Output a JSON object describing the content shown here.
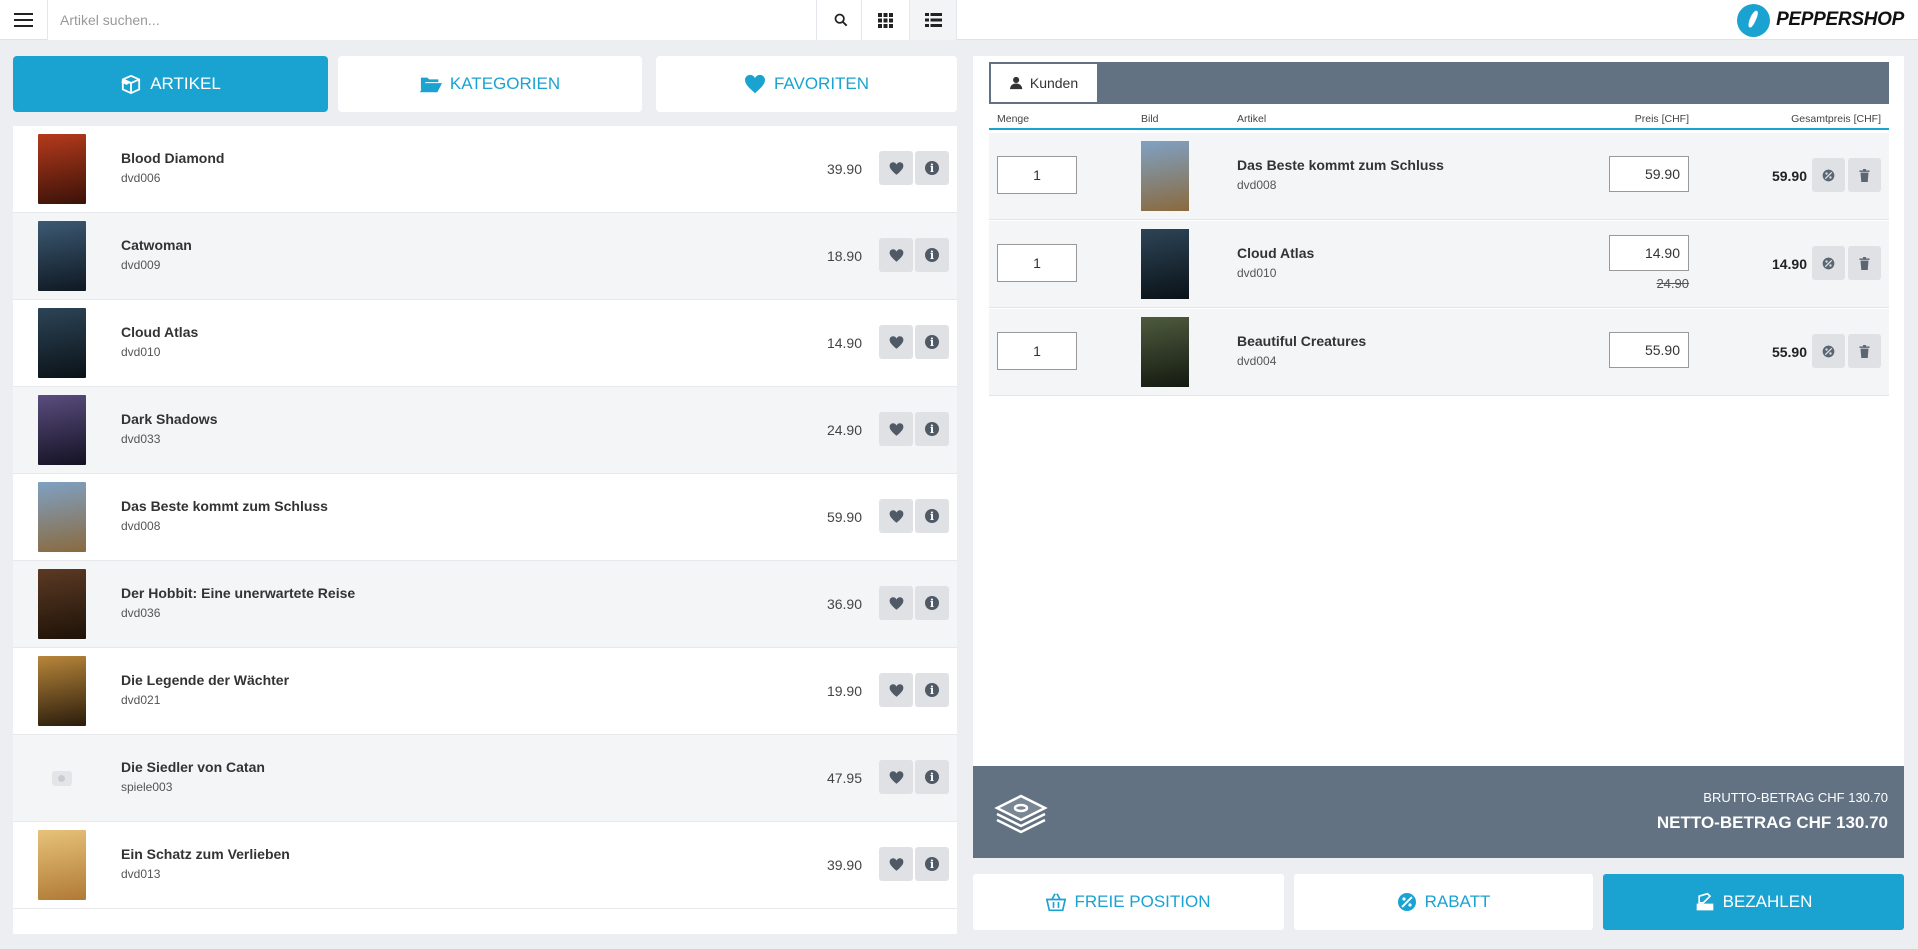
{
  "app": {
    "brand_name": "PEPPERSHOP"
  },
  "search": {
    "placeholder": "Artikel suchen..."
  },
  "nav_tabs": [
    {
      "label": "ARTIKEL",
      "icon": "box-icon",
      "active": true
    },
    {
      "label": "KATEGORIEN",
      "icon": "folder-open-icon",
      "active": false
    },
    {
      "label": "FAVORITEN",
      "icon": "heart-icon",
      "active": false
    }
  ],
  "products": [
    {
      "name": "Blood Diamond",
      "sku": "dvd006",
      "price": "39.90",
      "poster_colors": [
        "#b53a1c",
        "#3a1208"
      ]
    },
    {
      "name": "Catwoman",
      "sku": "dvd009",
      "price": "18.90",
      "poster_colors": [
        "#3c5a74",
        "#0f1822"
      ]
    },
    {
      "name": "Cloud Atlas",
      "sku": "dvd010",
      "price": "14.90",
      "poster_colors": [
        "#2d4456",
        "#0a1218"
      ]
    },
    {
      "name": "Dark Shadows",
      "sku": "dvd033",
      "price": "24.90",
      "poster_colors": [
        "#5a4d7e",
        "#141224"
      ]
    },
    {
      "name": "Das Beste kommt zum Schluss",
      "sku": "dvd008",
      "price": "59.90",
      "poster_colors": [
        "#7fa1c4",
        "#8a6a3e"
      ]
    },
    {
      "name": "Der Hobbit: Eine unerwartete Reise",
      "sku": "dvd036",
      "price": "36.90",
      "poster_colors": [
        "#5b3a24",
        "#1e1208"
      ]
    },
    {
      "name": "Die Legende der Wächter",
      "sku": "dvd021",
      "price": "19.90",
      "poster_colors": [
        "#b8863a",
        "#2a1c0c"
      ]
    },
    {
      "name": "Die Siedler von Catan",
      "sku": "spiele003",
      "price": "47.95",
      "poster_colors": null
    },
    {
      "name": "Ein Schatz zum Verlieben",
      "sku": "dvd013",
      "price": "39.90",
      "poster_colors": [
        "#e7c27a",
        "#b07a34"
      ]
    }
  ],
  "cart": {
    "customer_tab_label": "Kunden",
    "columns": {
      "qty": "Menge",
      "image": "Bild",
      "article": "Artikel",
      "price": "Preis [CHF]",
      "total": "Gesamtpreis [CHF]"
    },
    "items": [
      {
        "qty": "1",
        "name": "Das Beste kommt zum Schluss",
        "sku": "dvd008",
        "price": "59.90",
        "old_price": "",
        "total": "59.90",
        "poster_colors": [
          "#7fa1c4",
          "#8a6a3e"
        ]
      },
      {
        "qty": "1",
        "name": "Cloud Atlas",
        "sku": "dvd010",
        "price": "14.90",
        "old_price": "24.90",
        "total": "14.90",
        "poster_colors": [
          "#2d4456",
          "#0a1218"
        ]
      },
      {
        "qty": "1",
        "name": "Beautiful Creatures",
        "sku": "dvd004",
        "price": "55.90",
        "old_price": "",
        "total": "55.90",
        "poster_colors": [
          "#4e5a3e",
          "#141a10"
        ]
      }
    ]
  },
  "totals": {
    "brutto": "BRUTTO-BETRAG CHF 130.70",
    "netto": "NETTO-BETRAG CHF 130.70"
  },
  "actions": {
    "free_position": "FREIE POSITION",
    "discount": "RABATT",
    "pay": "BEZAHLEN"
  },
  "colors": {
    "accent": "#1aa3d0",
    "slate": "#627282"
  }
}
